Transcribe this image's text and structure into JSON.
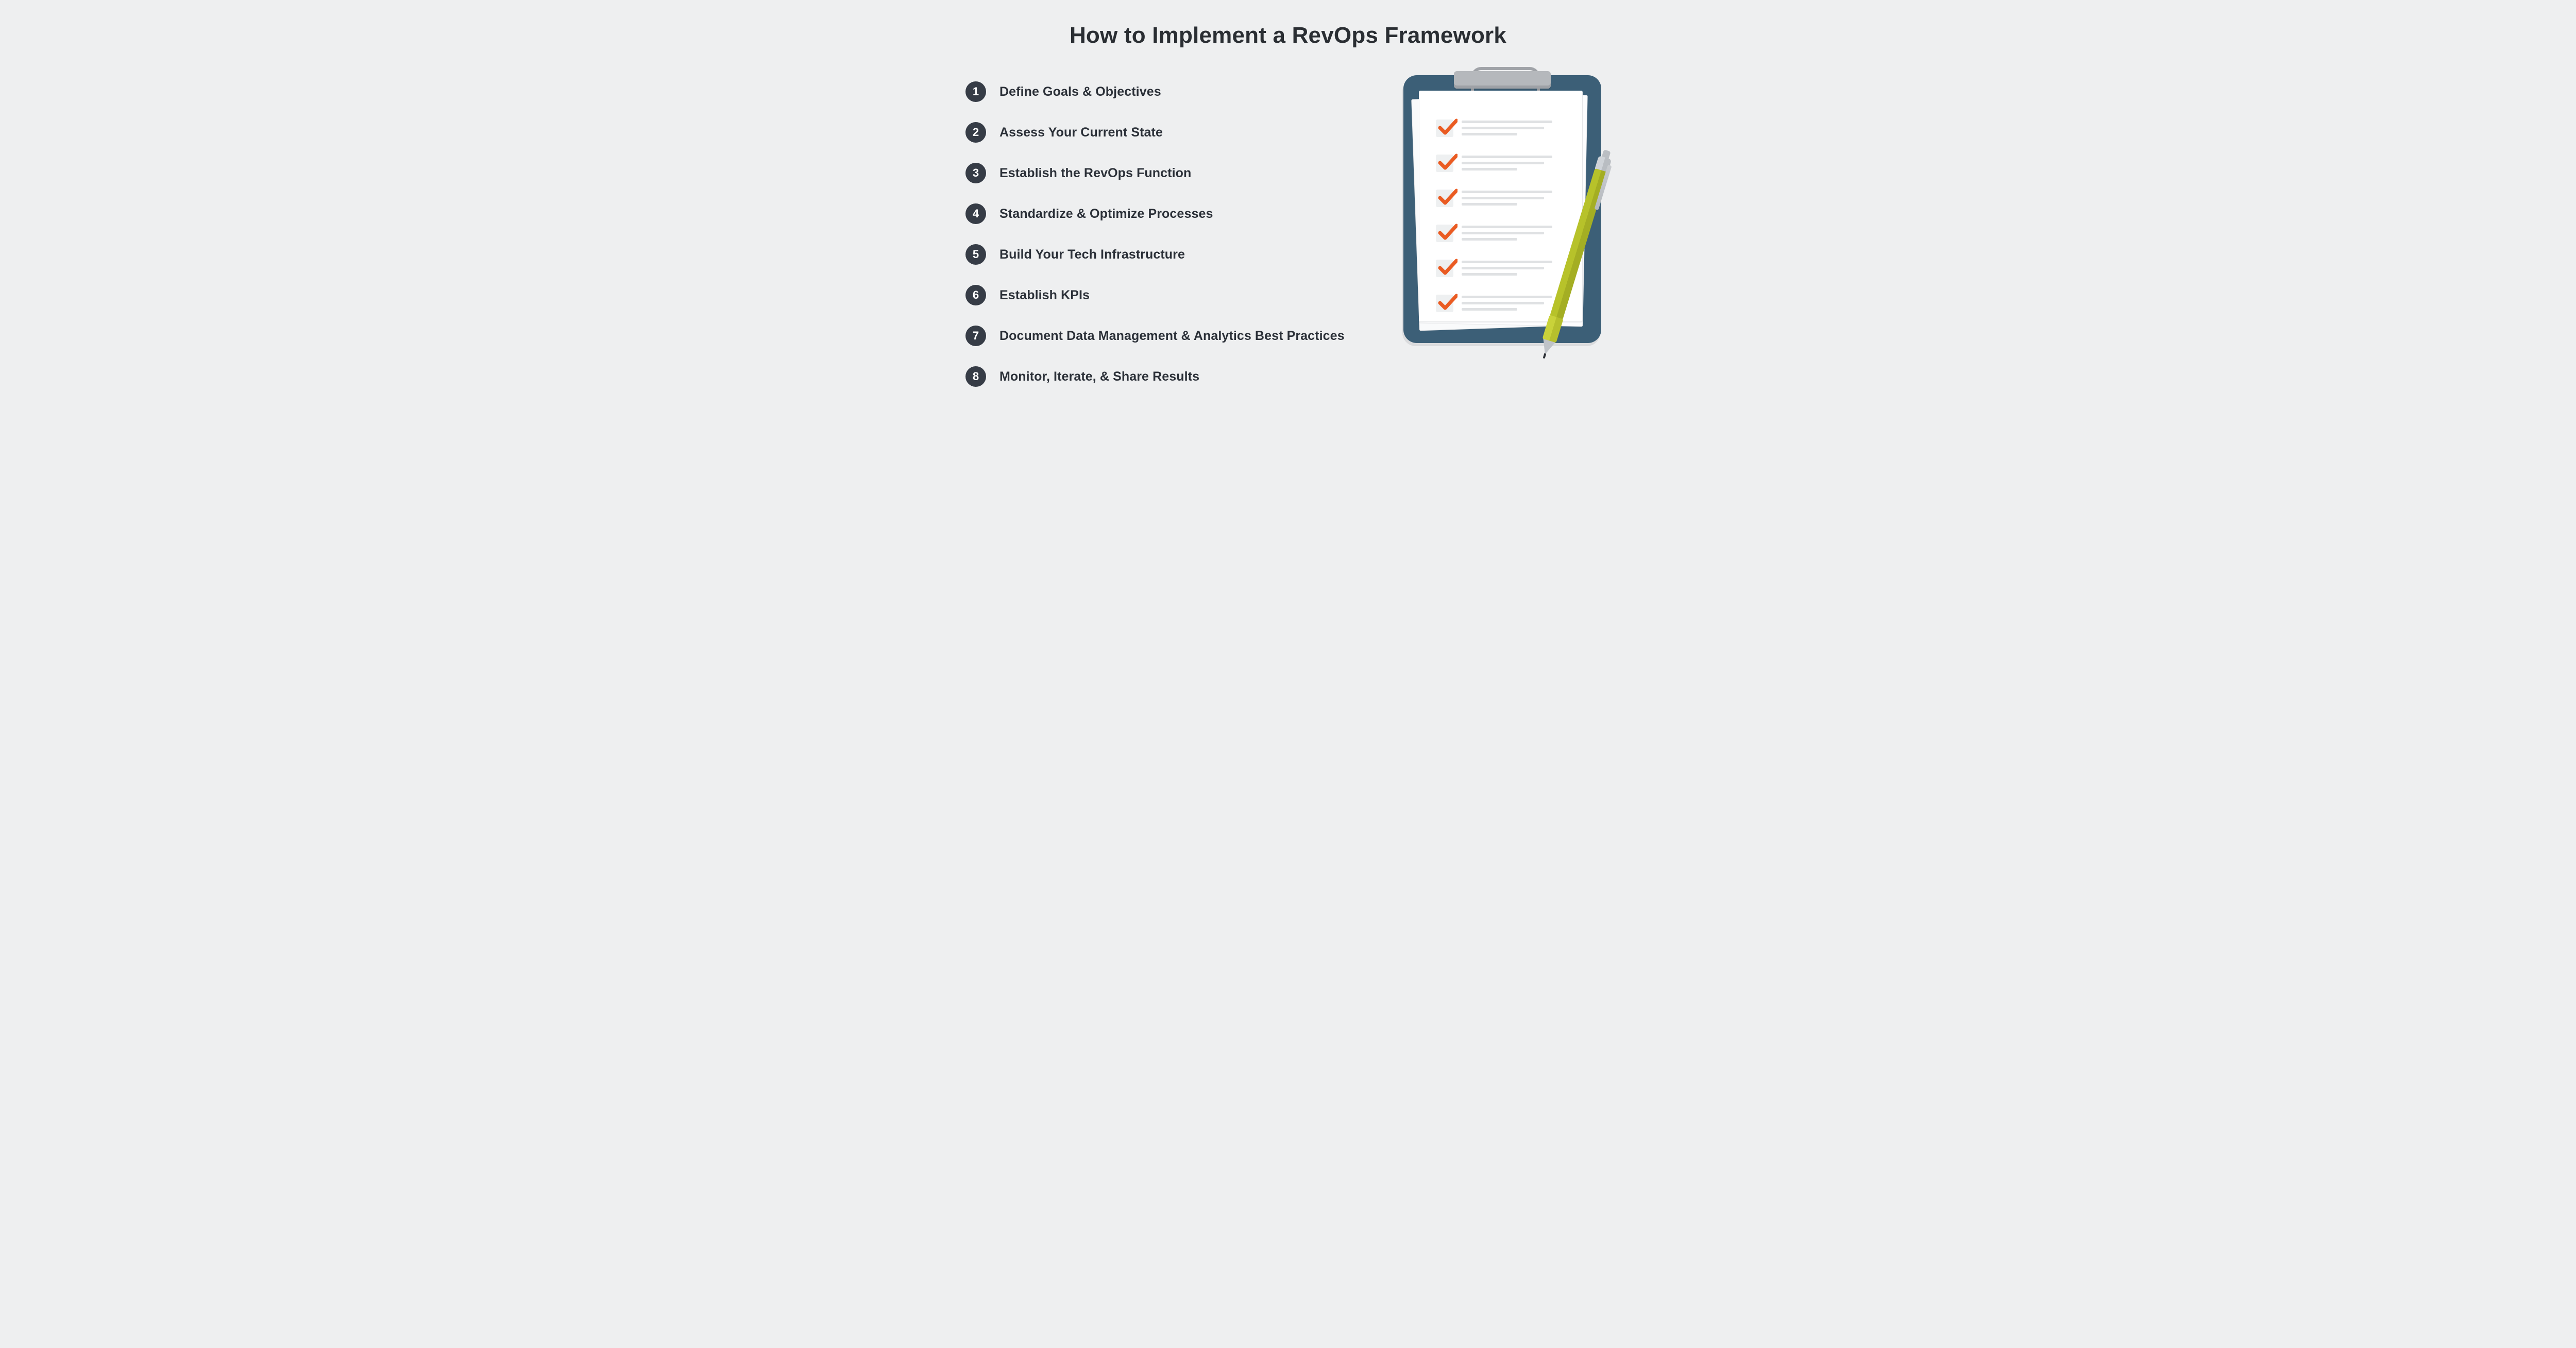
{
  "title": "How to Implement a RevOps Framework",
  "steps": [
    {
      "num": "1",
      "label": "Define Goals & Objectives"
    },
    {
      "num": "2",
      "label": "Assess Your Current State"
    },
    {
      "num": "3",
      "label": "Establish the RevOps Function"
    },
    {
      "num": "4",
      "label": "Standardize & Optimize Processes"
    },
    {
      "num": "5",
      "label": "Build Your Tech Infrastructure"
    },
    {
      "num": "6",
      "label": "Establish KPIs"
    },
    {
      "num": "7",
      "label": "Document Data Management & Analytics Best Practices"
    },
    {
      "num": "8",
      "label": "Monitor, Iterate, & Share Results"
    }
  ],
  "illustration": {
    "check_items": 6,
    "check_color": "#ea5b22",
    "clipboard_color": "#3c5f77",
    "pen_color": "#b7c22a"
  }
}
